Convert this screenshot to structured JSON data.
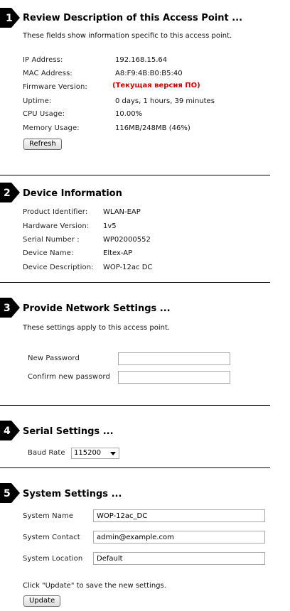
{
  "s1": {
    "num": "1",
    "title": "Review Description of this Access Point ...",
    "desc": "These fields show information specific to this access point.",
    "rows": [
      {
        "label": "IP Address:",
        "value": "192.168.15.64"
      },
      {
        "label": "MAC Address:",
        "value": "A8:F9:4B:B0:B5:40"
      },
      {
        "label": "Firmware Version:",
        "value": "(Текущая версия ПО)"
      },
      {
        "label": "Uptime:",
        "value": "0 days, 1 hours, 39 minutes"
      },
      {
        "label": "CPU Usage:",
        "value": "10.00%"
      },
      {
        "label": "Memory Usage:",
        "value": "116MB/248MB (46%)"
      }
    ],
    "refresh": "Refresh"
  },
  "s2": {
    "num": "2",
    "title": "Device Information",
    "rows": [
      {
        "label": "Product Identifier:",
        "value": "WLAN-EAP"
      },
      {
        "label": "Hardware Version:",
        "value": "1v5"
      },
      {
        "label": "Serial Number :",
        "value": "WP02000552"
      },
      {
        "label": "Device Name:",
        "value": "Eltex-AP"
      },
      {
        "label": "Device Description:",
        "value": "WOP-12ac DC"
      }
    ]
  },
  "s3": {
    "num": "3",
    "title": "Provide Network Settings ...",
    "desc": "These settings apply to this access point.",
    "new_password_label": "New Password",
    "confirm_password_label": "Confirm new password",
    "new_password_value": "",
    "confirm_password_value": ""
  },
  "s4": {
    "num": "4",
    "title": "Serial Settings ...",
    "baud_label": "Baud Rate",
    "baud_value": "115200"
  },
  "s5": {
    "num": "5",
    "title": "System Settings ...",
    "name_label": "System Name",
    "name_value": "WOP-12ac_DC",
    "contact_label": "System Contact",
    "contact_value": "admin@example.com",
    "location_label": "System Location",
    "location_value": "Default",
    "hint": "Click \"Update\" to save the new settings.",
    "update": "Update"
  },
  "colors": {
    "accent_red": "#d60000",
    "rule": "#000000"
  },
  "icons": [
    "step-1-badge-icon",
    "step-2-badge-icon",
    "step-3-badge-icon",
    "step-4-badge-icon",
    "step-5-badge-icon",
    "dropdown-arrow-icon"
  ]
}
